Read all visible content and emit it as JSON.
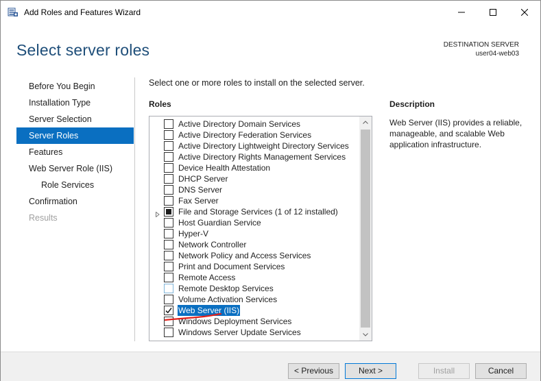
{
  "window": {
    "title": "Add Roles and Features Wizard"
  },
  "header": {
    "page_title": "Select server roles",
    "destination_label": "DESTINATION SERVER",
    "destination_value": "user04-web03"
  },
  "nav": {
    "items": [
      {
        "label": "Before You Begin",
        "state": "normal"
      },
      {
        "label": "Installation Type",
        "state": "normal"
      },
      {
        "label": "Server Selection",
        "state": "normal"
      },
      {
        "label": "Server Roles",
        "state": "active"
      },
      {
        "label": "Features",
        "state": "normal"
      },
      {
        "label": "Web Server Role (IIS)",
        "state": "normal"
      },
      {
        "label": "Role Services",
        "state": "sub"
      },
      {
        "label": "Confirmation",
        "state": "normal"
      },
      {
        "label": "Results",
        "state": "disabled"
      }
    ]
  },
  "main": {
    "instruction": "Select one or more roles to install on the selected server.",
    "roles_heading": "Roles",
    "description_heading": "Description",
    "description_text": "Web Server (IIS) provides a reliable, manageable, and scalable Web application infrastructure.",
    "roles": [
      {
        "label": "Active Directory Domain Services",
        "state": "unchecked",
        "expandable": false
      },
      {
        "label": "Active Directory Federation Services",
        "state": "unchecked",
        "expandable": false
      },
      {
        "label": "Active Directory Lightweight Directory Services",
        "state": "unchecked",
        "expandable": false
      },
      {
        "label": "Active Directory Rights Management Services",
        "state": "unchecked",
        "expandable": false
      },
      {
        "label": "Device Health Attestation",
        "state": "unchecked",
        "expandable": false
      },
      {
        "label": "DHCP Server",
        "state": "unchecked",
        "expandable": false
      },
      {
        "label": "DNS Server",
        "state": "unchecked",
        "expandable": false
      },
      {
        "label": "Fax Server",
        "state": "unchecked",
        "expandable": false
      },
      {
        "label": "File and Storage Services (1 of 12 installed)",
        "state": "partial",
        "expandable": true
      },
      {
        "label": "Host Guardian Service",
        "state": "unchecked",
        "expandable": false
      },
      {
        "label": "Hyper-V",
        "state": "unchecked",
        "expandable": false
      },
      {
        "label": "Network Controller",
        "state": "unchecked",
        "expandable": false
      },
      {
        "label": "Network Policy and Access Services",
        "state": "unchecked",
        "expandable": false
      },
      {
        "label": "Print and Document Services",
        "state": "unchecked",
        "expandable": false
      },
      {
        "label": "Remote Access",
        "state": "unchecked",
        "expandable": false
      },
      {
        "label": "Remote Desktop Services",
        "state": "light",
        "expandable": false
      },
      {
        "label": "Volume Activation Services",
        "state": "unchecked",
        "expandable": false
      },
      {
        "label": "Web Server (IIS)",
        "state": "checked",
        "expandable": false,
        "selected": true
      },
      {
        "label": "Windows Deployment Services",
        "state": "unchecked",
        "expandable": false
      },
      {
        "label": "Windows Server Update Services",
        "state": "unchecked",
        "expandable": false
      }
    ]
  },
  "footer": {
    "previous_label": "< Previous",
    "next_label": "Next >",
    "install_label": "Install",
    "cancel_label": "Cancel"
  },
  "colors": {
    "accent": "#0a6fc1",
    "title_blue": "#1e4e79",
    "annotation_red": "#e0201a"
  }
}
